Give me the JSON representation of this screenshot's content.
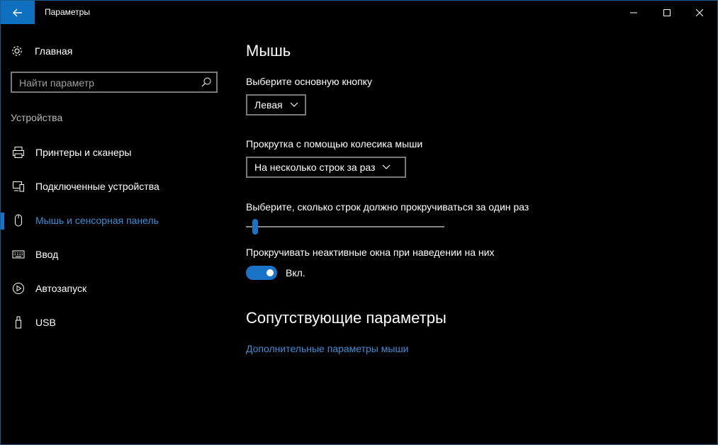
{
  "window": {
    "title": "Параметры",
    "accent_color": "#1070c0",
    "controls": [
      "minimize-icon",
      "maximize-icon",
      "close-icon"
    ]
  },
  "sidebar": {
    "home_label": "Главная",
    "search": {
      "placeholder": "Найти параметр"
    },
    "section_title": "Устройства",
    "items": [
      {
        "label": "Принтеры и сканеры",
        "icon": "printer-icon",
        "active": false
      },
      {
        "label": "Подключенные устройства",
        "icon": "devices-icon",
        "active": false
      },
      {
        "label": "Мышь и сенсорная панель",
        "icon": "mouse-icon",
        "active": true
      },
      {
        "label": "Ввод",
        "icon": "keyboard-icon",
        "active": false
      },
      {
        "label": "Автозапуск",
        "icon": "autoplay-icon",
        "active": false
      },
      {
        "label": "USB",
        "icon": "usb-icon",
        "active": false
      }
    ]
  },
  "main": {
    "title": "Мышь",
    "primary_button": {
      "label": "Выберите основную кнопку",
      "value": "Левая"
    },
    "scroll_mode": {
      "label": "Прокрутка с помощью колесика мыши",
      "value": "На несколько строк за раз"
    },
    "lines_slider": {
      "label": "Выберите, сколько строк должно прокручиваться за один раз",
      "fraction": 0.02
    },
    "inactive_scroll": {
      "label": "Прокручивать неактивные окна при наведении на них",
      "state": "Вкл.",
      "on": true
    },
    "related": {
      "title": "Сопутствующие параметры",
      "link": "Дополнительные параметры мыши"
    }
  }
}
